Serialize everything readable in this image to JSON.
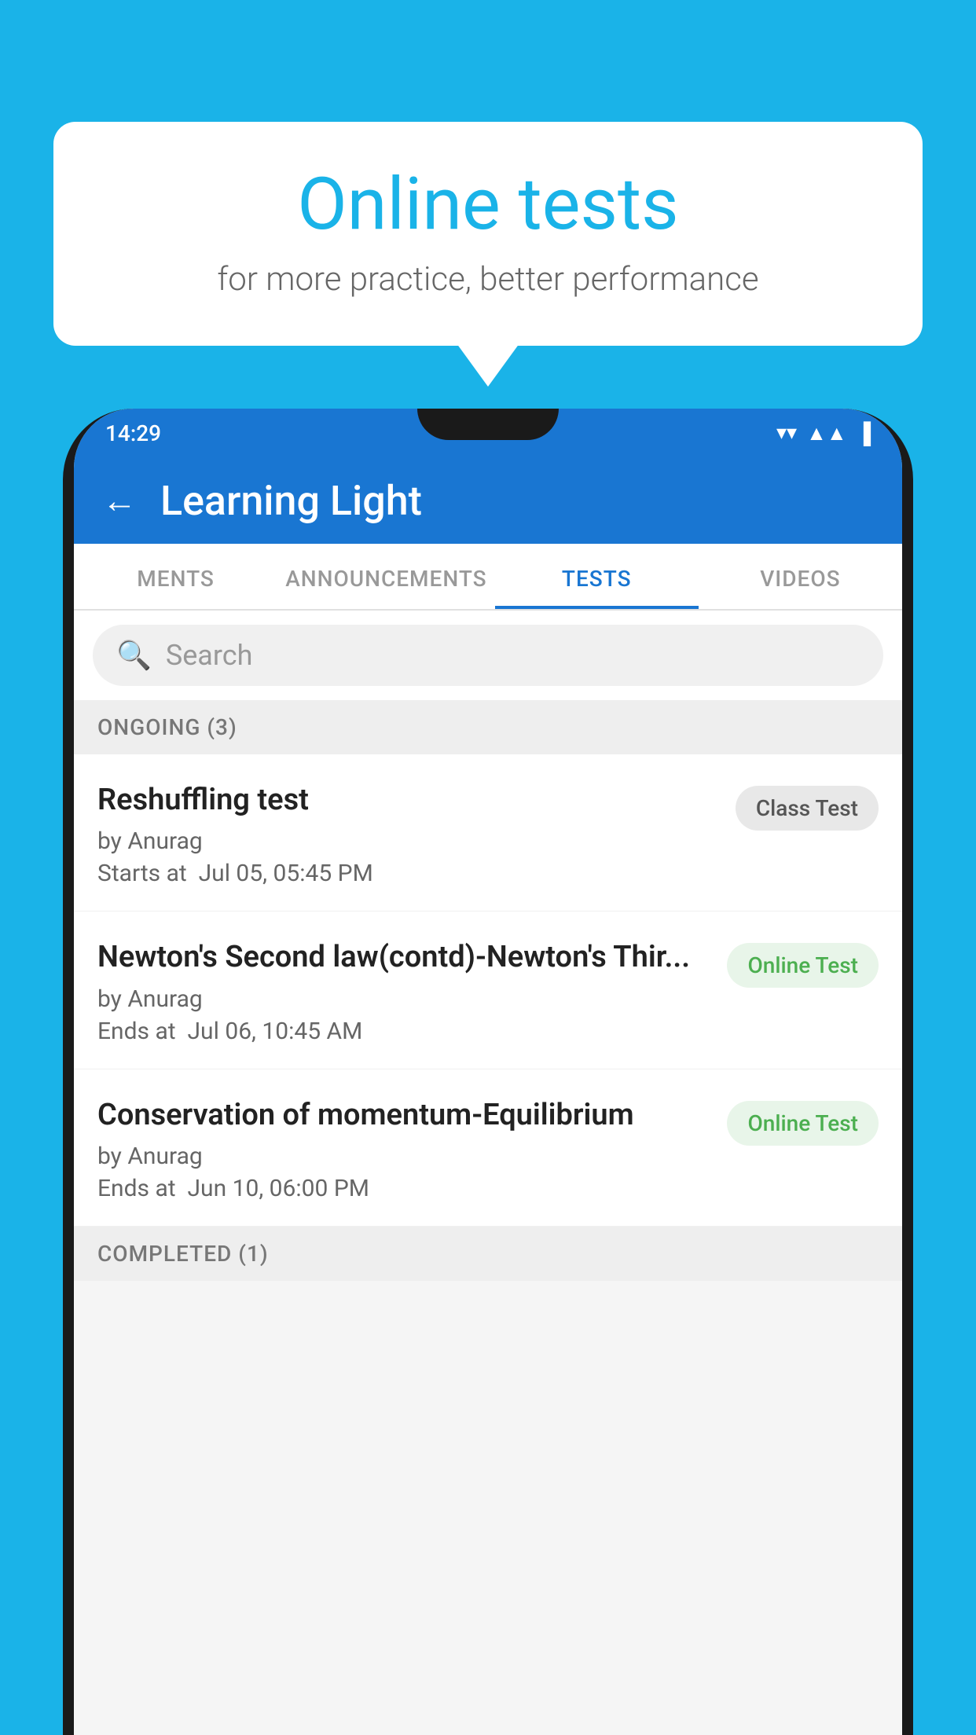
{
  "background_color": "#1ab3e8",
  "bubble": {
    "title": "Online tests",
    "subtitle": "for more practice, better performance"
  },
  "status_bar": {
    "time": "14:29",
    "icons": [
      "▼",
      "▲",
      "▌"
    ]
  },
  "app_bar": {
    "back_label": "←",
    "title": "Learning Light"
  },
  "tabs": [
    {
      "label": "MENTS",
      "active": false
    },
    {
      "label": "ANNOUNCEMENTS",
      "active": false
    },
    {
      "label": "TESTS",
      "active": true
    },
    {
      "label": "VIDEOS",
      "active": false
    }
  ],
  "search": {
    "placeholder": "Search",
    "icon": "🔍"
  },
  "ongoing_section": {
    "title": "ONGOING (3)"
  },
  "tests": [
    {
      "name": "Reshuffling test",
      "by": "by Anurag",
      "date_label": "Starts at",
      "date": "Jul 05, 05:45 PM",
      "badge": "Class Test",
      "badge_type": "class"
    },
    {
      "name": "Newton's Second law(contd)-Newton's Thir...",
      "by": "by Anurag",
      "date_label": "Ends at",
      "date": "Jul 06, 10:45 AM",
      "badge": "Online Test",
      "badge_type": "online"
    },
    {
      "name": "Conservation of momentum-Equilibrium",
      "by": "by Anurag",
      "date_label": "Ends at",
      "date": "Jun 10, 06:00 PM",
      "badge": "Online Test",
      "badge_type": "online"
    }
  ],
  "completed_section": {
    "title": "COMPLETED (1)"
  }
}
